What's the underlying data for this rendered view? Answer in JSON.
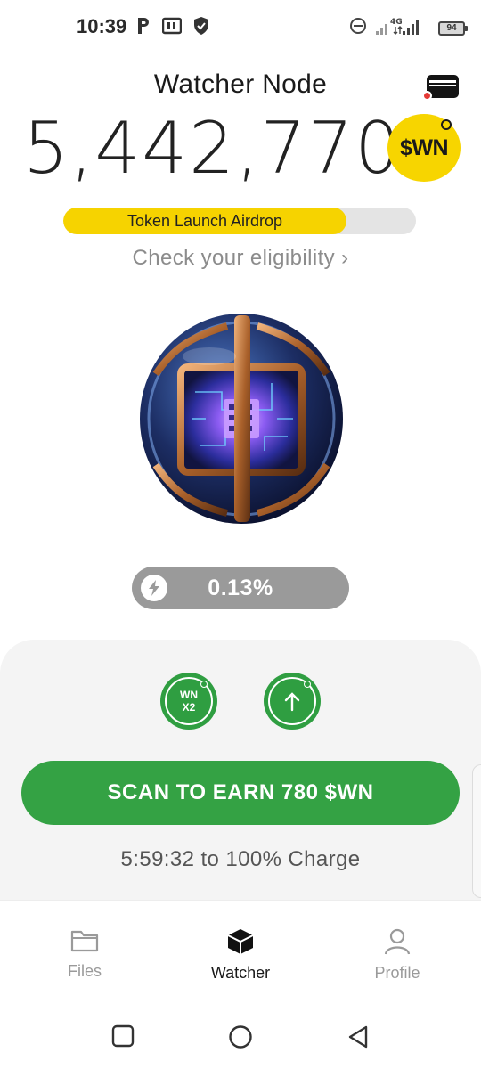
{
  "status_bar": {
    "time": "10:39",
    "network": "4G",
    "battery": "94"
  },
  "header": {
    "title": "Watcher Node",
    "balance": "5,442,770",
    "token_badge": "$WN"
  },
  "airdrop": {
    "label": "Token Launch Airdrop",
    "progress": 0.803,
    "link_text": "Check your eligibility ›"
  },
  "charge": {
    "value": "0.13%"
  },
  "boosts": {
    "multiplier_line1": "WN",
    "multiplier_line2": "X2"
  },
  "action": {
    "scan_label": "SCAN TO EARN 780 $WN",
    "timer_text": "5:59:32 to 100% Charge"
  },
  "bottom_nav": {
    "items": [
      {
        "label": "Files",
        "icon": "folder-icon",
        "active": false
      },
      {
        "label": "Watcher",
        "icon": "cube-icon",
        "active": true
      },
      {
        "label": "Profile",
        "icon": "user-icon",
        "active": false
      }
    ]
  },
  "colors": {
    "accent_green": "#34a244",
    "accent_yellow": "#f6d300",
    "notification_red": "#e53935"
  }
}
